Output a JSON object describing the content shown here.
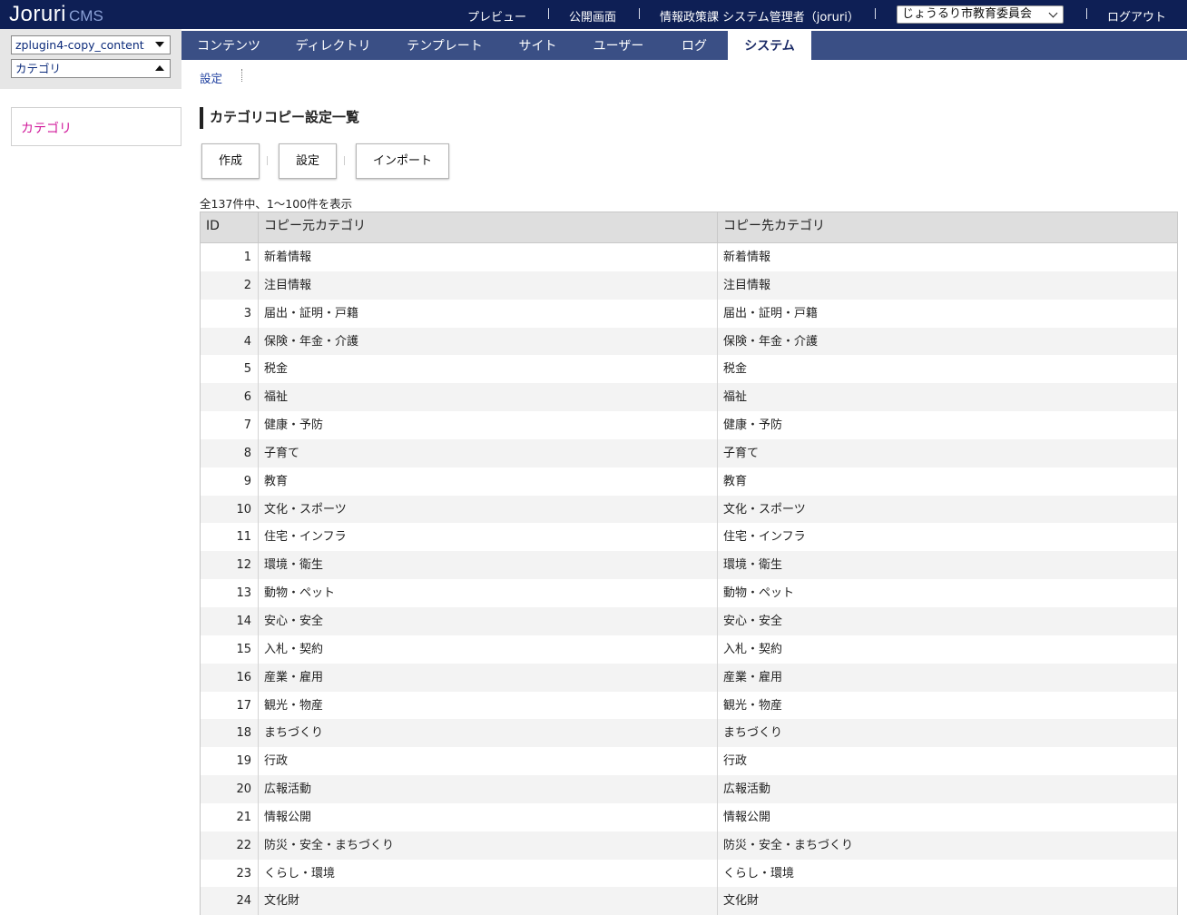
{
  "header": {
    "logo_main": "Joruri",
    "logo_sub": "CMS",
    "links": {
      "preview": "プレビュー",
      "public": "公開画面",
      "user": "情報政策課 システム管理者（joruri）",
      "logout": "ログアウト"
    },
    "org_select": "じょうるり市教育委員会"
  },
  "left": {
    "content_select": "zplugin4-copy_content",
    "module_select": "カテゴリ",
    "nav_item": "カテゴリ"
  },
  "mainnav": {
    "tabs": [
      "コンテンツ",
      "ディレクトリ",
      "テンプレート",
      "サイト",
      "ユーザー",
      "ログ",
      "システム"
    ]
  },
  "subnav": {
    "setting": "設定"
  },
  "page": {
    "title": "カテゴリコピー設定一覧",
    "buttons": {
      "create": "作成",
      "setting": "設定",
      "import": "インポート"
    },
    "count": "全137件中、1〜100件を表示"
  },
  "table": {
    "headers": {
      "id": "ID",
      "src": "コピー元カテゴリ",
      "dst": "コピー先カテゴリ"
    },
    "rows": [
      {
        "id": "1",
        "src": "新着情報",
        "dst": "新着情報"
      },
      {
        "id": "2",
        "src": "注目情報",
        "dst": "注目情報"
      },
      {
        "id": "3",
        "src": "届出・証明・戸籍",
        "dst": "届出・証明・戸籍"
      },
      {
        "id": "4",
        "src": "保険・年金・介護",
        "dst": "保険・年金・介護"
      },
      {
        "id": "5",
        "src": "税金",
        "dst": "税金"
      },
      {
        "id": "6",
        "src": "福祉",
        "dst": "福祉"
      },
      {
        "id": "7",
        "src": "健康・予防",
        "dst": "健康・予防"
      },
      {
        "id": "8",
        "src": "子育て",
        "dst": "子育て"
      },
      {
        "id": "9",
        "src": "教育",
        "dst": "教育"
      },
      {
        "id": "10",
        "src": "文化・スポーツ",
        "dst": "文化・スポーツ"
      },
      {
        "id": "11",
        "src": "住宅・インフラ",
        "dst": "住宅・インフラ"
      },
      {
        "id": "12",
        "src": "環境・衛生",
        "dst": "環境・衛生"
      },
      {
        "id": "13",
        "src": "動物・ペット",
        "dst": "動物・ペット"
      },
      {
        "id": "14",
        "src": "安心・安全",
        "dst": "安心・安全"
      },
      {
        "id": "15",
        "src": "入札・契約",
        "dst": "入札・契約"
      },
      {
        "id": "16",
        "src": "産業・雇用",
        "dst": "産業・雇用"
      },
      {
        "id": "17",
        "src": "観光・物産",
        "dst": "観光・物産"
      },
      {
        "id": "18",
        "src": "まちづくり",
        "dst": "まちづくり"
      },
      {
        "id": "19",
        "src": "行政",
        "dst": "行政"
      },
      {
        "id": "20",
        "src": "広報活動",
        "dst": "広報活動"
      },
      {
        "id": "21",
        "src": "情報公開",
        "dst": "情報公開"
      },
      {
        "id": "22",
        "src": "防災・安全・まちづくり",
        "dst": "防災・安全・まちづくり"
      },
      {
        "id": "23",
        "src": "くらし・環境",
        "dst": "くらし・環境"
      },
      {
        "id": "24",
        "src": "文化財",
        "dst": "文化財"
      }
    ]
  },
  "colors": {
    "header_bg": "#0e1f55",
    "nav_bg": "#3a4f85",
    "accent_link": "#d0189a"
  }
}
